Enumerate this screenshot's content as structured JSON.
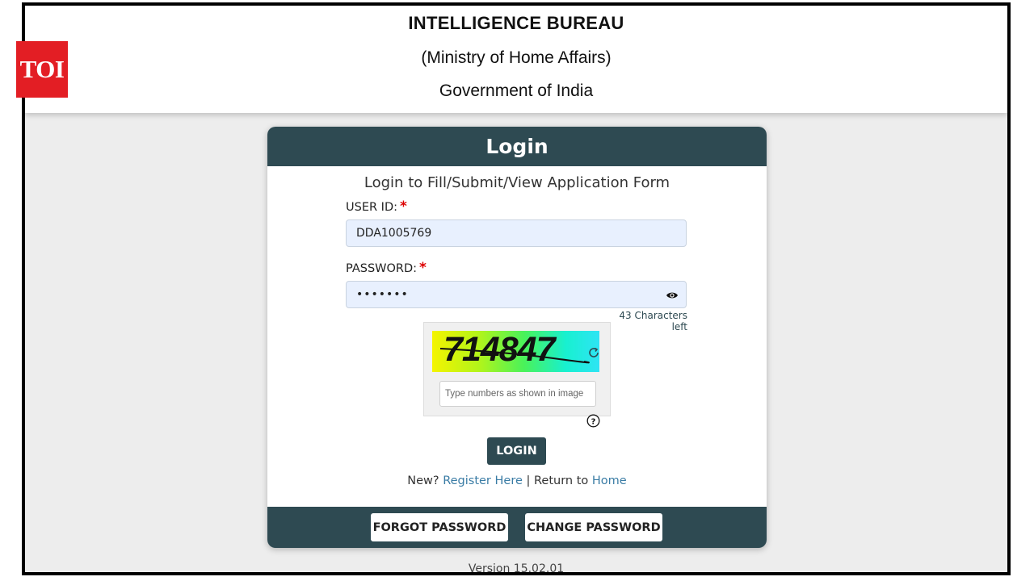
{
  "header": {
    "org_name": "INTELLIGENCE BUREAU",
    "ministry": "(Ministry of Home Affairs)",
    "government": "Government of India"
  },
  "watermark": {
    "logo_text": "TOI"
  },
  "login_card": {
    "title": "Login",
    "subtitle": "Login to Fill/Submit/View Application Form",
    "user_id": {
      "label": "USER ID:",
      "required_mark": "*",
      "value": "DDA1005769"
    },
    "password": {
      "label": "PASSWORD:",
      "required_mark": "*",
      "value": "•••••••",
      "chars_left": "43 Characters left",
      "toggle_icon": "eye-icon"
    },
    "captcha": {
      "image_text": "714847",
      "input_placeholder": "Type numbers as shown in image",
      "refresh_icon": "refresh-icon",
      "help_icon": "question-circle-icon"
    },
    "login_button": "LOGIN",
    "links": {
      "new_prefix": "New?",
      "register": "Register Here",
      "separator": "|",
      "return_prefix": "Return to",
      "home": "Home"
    },
    "forgot_password_button": "FORGOT PASSWORD",
    "change_password_button": "CHANGE PASSWORD"
  },
  "footer": {
    "version": "Version 15.02.01"
  },
  "colors": {
    "primary": "#2e4a52",
    "field_background": "#e8f0fe",
    "required": "#dd0000",
    "link": "#3a7ca5",
    "page_background": "#ededed",
    "watermark_red": "#e31e24"
  }
}
